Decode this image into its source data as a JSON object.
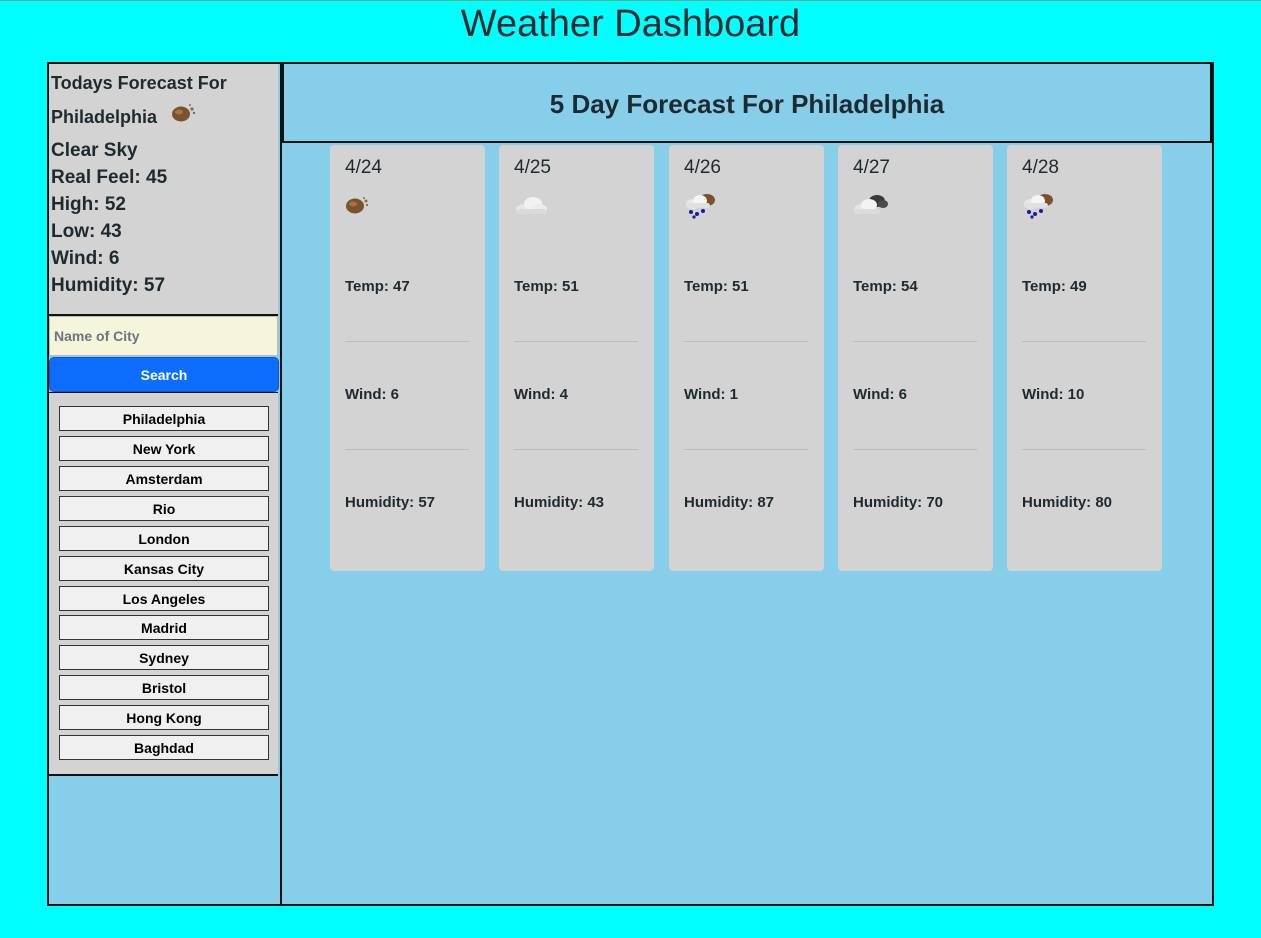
{
  "app_title": "Weather Dashboard",
  "today": {
    "heading": "Todays Forecast For Philadelphia",
    "icon": "partly-cloudy-icon",
    "description": "Clear Sky",
    "real_feel": "Real Feel: 45",
    "high": "High: 52",
    "low": "Low: 43",
    "wind": "Wind: 6",
    "humidity": "Humidity: 57"
  },
  "search": {
    "placeholder": "Name of City",
    "button_label": "Search"
  },
  "history": [
    "Philadelphia",
    "New York",
    "Amsterdam",
    "Rio",
    "London",
    "Kansas City",
    "Los Angeles",
    "Madrid",
    "Sydney",
    "Bristol",
    "Hong Kong",
    "Baghdad"
  ],
  "forecast": {
    "heading": "5 Day Forecast For Philadelphia",
    "days": [
      {
        "date": "4/24",
        "icon": "partly-cloudy-icon",
        "temp": "Temp: 47",
        "wind": "Wind: 6",
        "humidity": "Humidity: 57"
      },
      {
        "date": "4/25",
        "icon": "cloud-icon",
        "temp": "Temp: 51",
        "wind": "Wind: 4",
        "humidity": "Humidity: 43"
      },
      {
        "date": "4/26",
        "icon": "rain-icon",
        "temp": "Temp: 51",
        "wind": "Wind: 1",
        "humidity": "Humidity: 87"
      },
      {
        "date": "4/27",
        "icon": "overcast-icon",
        "temp": "Temp: 54",
        "wind": "Wind: 6",
        "humidity": "Humidity: 70"
      },
      {
        "date": "4/28",
        "icon": "rain-icon",
        "temp": "Temp: 49",
        "wind": "Wind: 10",
        "humidity": "Humidity: 80"
      }
    ]
  },
  "colors": {
    "page_background": "#00ffff",
    "panel_background": "#87ceeb",
    "card_background": "#d3d3d3",
    "search_button": "#0d6efd",
    "input_background": "#f5f5dc"
  }
}
